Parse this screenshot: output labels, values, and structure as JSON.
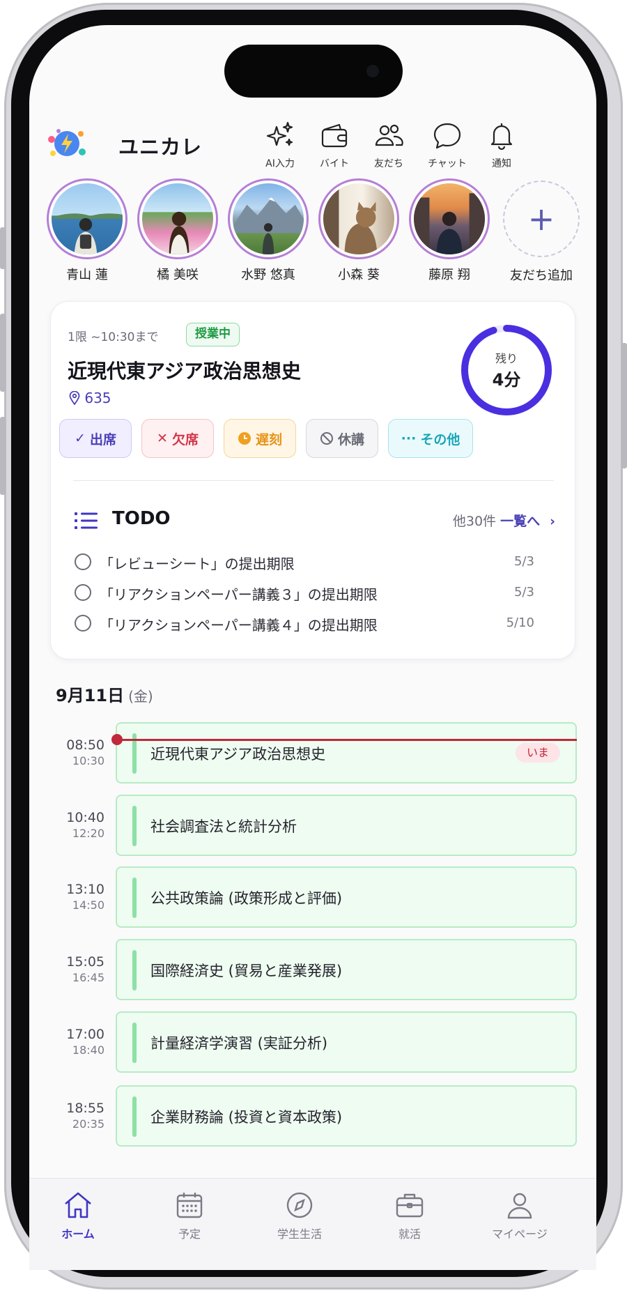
{
  "app": {
    "title": "ユニカレ"
  },
  "header_actions": [
    {
      "label": "AI入力",
      "icon": "sparkles-icon"
    },
    {
      "label": "バイト",
      "icon": "wallet-icon"
    },
    {
      "label": "友だち",
      "icon": "friends-icon"
    },
    {
      "label": "チャット",
      "icon": "chat-icon"
    },
    {
      "label": "通知",
      "icon": "bell-icon"
    }
  ],
  "stories": [
    {
      "name": "青山 蓮"
    },
    {
      "name": "橘 美咲"
    },
    {
      "name": "水野 悠真"
    },
    {
      "name": "小森 葵"
    },
    {
      "name": "藤原 翔"
    }
  ],
  "add_friend": {
    "label": "友だち追加"
  },
  "current_class": {
    "period": "1限 ~10:30まで",
    "status": "授業中",
    "name": "近現代東アジア政治思想史",
    "room": "635",
    "remaining_label": "残り",
    "remaining": "4分",
    "remaining_fraction": 0.95
  },
  "attendance": {
    "present": "出席",
    "absent": "欠席",
    "late": "遅刻",
    "cancelled": "休講",
    "other": "その他"
  },
  "todo": {
    "title": "TODO",
    "more_count": "他30件",
    "more_link": "一覧へ",
    "items": [
      {
        "text": "「レビューシート」の提出期限",
        "due": "5/3"
      },
      {
        "text": "「リアクションペーパー講義３」の提出期限",
        "due": "5/3"
      },
      {
        "text": "「リアクションペーパー講義４」の提出期限",
        "due": "5/10"
      }
    ]
  },
  "schedule": {
    "date": "9月11日",
    "weekday": "(金)",
    "now_label": "いま",
    "classes": [
      {
        "start": "08:50",
        "end": "10:30",
        "name": "近現代東アジア政治思想史"
      },
      {
        "start": "10:40",
        "end": "12:20",
        "name": "社会調査法と統計分析"
      },
      {
        "start": "13:10",
        "end": "14:50",
        "name": "公共政策論 (政策形成と評価)"
      },
      {
        "start": "15:05",
        "end": "16:45",
        "name": "国際経済史 (貿易と産業発展)"
      },
      {
        "start": "17:00",
        "end": "18:40",
        "name": "計量経済学演習 (実証分析)"
      },
      {
        "start": "18:55",
        "end": "20:35",
        "name": "企業財務論 (投資と資本政策)"
      }
    ]
  },
  "tabbar": [
    {
      "label": "ホーム",
      "active": true
    },
    {
      "label": "予定"
    },
    {
      "label": "学生生活"
    },
    {
      "label": "就活"
    },
    {
      "label": "マイページ"
    }
  ],
  "colors": {
    "accent": "#3f35c4",
    "now_line": "#c0283c",
    "class_bg": "#effcf1",
    "story_ring": "#b57ed6"
  }
}
